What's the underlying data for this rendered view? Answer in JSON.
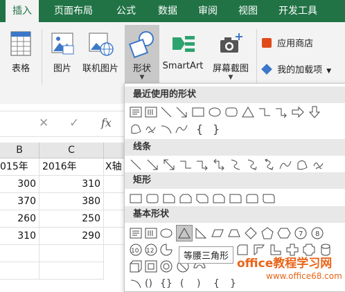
{
  "tabs": [
    "插入",
    "页面布局",
    "公式",
    "数据",
    "审阅",
    "视图",
    "开发工具"
  ],
  "ribbon": {
    "table": "表格",
    "picture": "图片",
    "online_picture": "联机图片",
    "shapes": "形状",
    "smartart": "SmartArt",
    "screenshot": "屏幕截图",
    "app_store": "应用商店",
    "my_addins": "我的加载项"
  },
  "formula_bar": {
    "cancel": "✕",
    "enter": "✓",
    "fx": "fx"
  },
  "grid": {
    "columns": [
      "B",
      "C"
    ],
    "rows": [
      [
        "015年",
        "2016年",
        "X轴"
      ],
      [
        "300",
        "310"
      ],
      [
        "370",
        "380"
      ],
      [
        "260",
        "250"
      ],
      [
        "310",
        "290"
      ]
    ]
  },
  "shapes_panel": {
    "sections": [
      "最近使用的形状",
      "线条",
      "矩形",
      "基本形状"
    ],
    "tooltip": "等腰三角形"
  },
  "watermark": {
    "main": "office教程学习网",
    "sub": "www.office68.com"
  },
  "colors": {
    "accent": "#217346"
  }
}
